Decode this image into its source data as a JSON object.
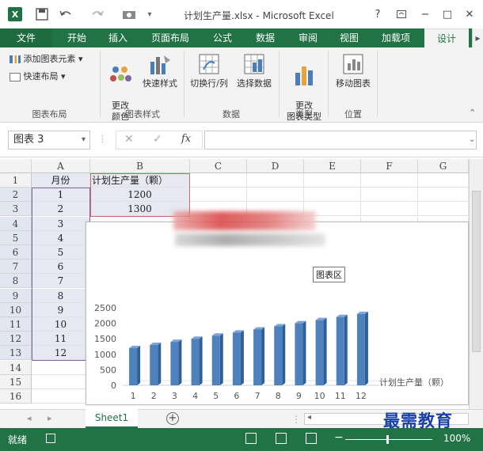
{
  "window": {
    "title": "计划生产量.xlsx - Microsoft Excel",
    "help": "?",
    "minimize": "−",
    "restore": "□",
    "close": "✕"
  },
  "tabs": [
    {
      "label": "文件"
    },
    {
      "label": "开始"
    },
    {
      "label": "插入"
    },
    {
      "label": "页面布局"
    },
    {
      "label": "公式"
    },
    {
      "label": "数据"
    },
    {
      "label": "审阅"
    },
    {
      "label": "视图"
    },
    {
      "label": "加载项"
    },
    {
      "label": "设计"
    }
  ],
  "ribbon": {
    "add_element": "添加图表元素",
    "quick_layout": "快速布局",
    "change_color": "更改\n颜色",
    "quick_styles": "快速样式",
    "switch_row_col": "切换行/列",
    "select_data": "选择数据",
    "change_type": "更改\n图表类型",
    "move_chart": "移动图表",
    "groups": {
      "layout": "图表布局",
      "styles": "图表样式",
      "data": "数据",
      "type": "类型",
      "location": "位置"
    }
  },
  "formula_bar": {
    "name_box": "图表 3",
    "fx": "fx",
    "value": ""
  },
  "columns": [
    "A",
    "B",
    "C",
    "D",
    "E",
    "F",
    "G"
  ],
  "rows": [
    "1",
    "2",
    "3",
    "4",
    "5",
    "6",
    "7",
    "8",
    "9",
    "10",
    "11",
    "12",
    "13",
    "14",
    "15",
    "16"
  ],
  "cells": {
    "A1": "月份",
    "B1": "计划生产量（颗）",
    "A2": "1",
    "B2": "1200",
    "A3": "2",
    "B3": "1300",
    "A4": "3",
    "A5": "4",
    "A6": "5",
    "A7": "6",
    "A8": "7",
    "A9": "8",
    "A10": "9",
    "A11": "10",
    "A12": "11",
    "A13": "12"
  },
  "chart_tip": "图表区",
  "chart_data": {
    "type": "bar",
    "categories": [
      "1",
      "2",
      "3",
      "4",
      "5",
      "6",
      "7",
      "8",
      "9",
      "10",
      "11",
      "12"
    ],
    "series": [
      {
        "name": "计划生产量（颗）",
        "values": [
          1200,
          1300,
          1400,
          1500,
          1600,
          1700,
          1800,
          1900,
          2000,
          2100,
          2200,
          2300
        ]
      }
    ],
    "ylim": [
      0,
      2500
    ],
    "yticks": [
      "0",
      "500",
      "1000",
      "1500",
      "2000",
      "2500"
    ],
    "legend": "right",
    "grid": false,
    "bar_color": "#4f81bd"
  },
  "sheet_tabs": [
    "Sheet1"
  ],
  "status": {
    "ready": "就绪",
    "zoom": "100%"
  },
  "watermark": "最需教育",
  "colors": {
    "excel_green": "#217346"
  }
}
